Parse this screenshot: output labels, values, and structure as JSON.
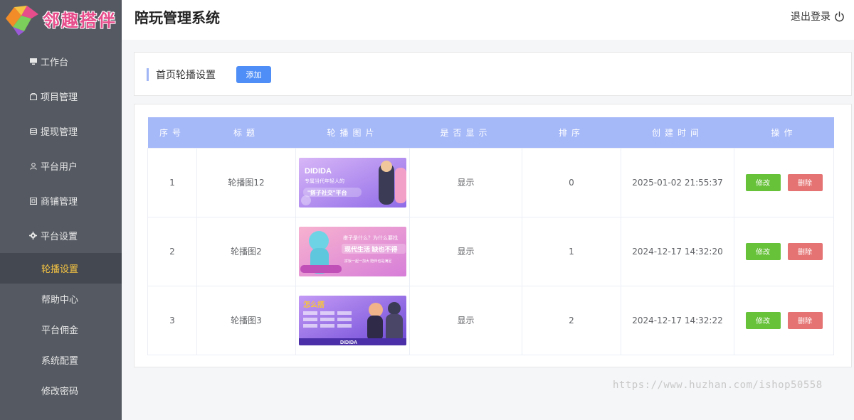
{
  "brand": {
    "logo_text": "邻趣搭伴"
  },
  "header": {
    "title": "陪玩管理系统",
    "logout_label": "退出登录"
  },
  "sidebar": {
    "items": [
      {
        "label": "工作台",
        "icon": "monitor-icon"
      },
      {
        "label": "项目管理",
        "icon": "box-icon"
      },
      {
        "label": "提现管理",
        "icon": "database-icon"
      },
      {
        "label": "平台用户",
        "icon": "user-icon"
      },
      {
        "label": "商铺管理",
        "icon": "store-icon"
      },
      {
        "label": "平台设置",
        "icon": "gear-icon"
      }
    ],
    "sub_items": [
      {
        "label": "轮播设置",
        "active": true
      },
      {
        "label": "帮助中心",
        "active": false
      },
      {
        "label": "平台佣金",
        "active": false
      },
      {
        "label": "系统配置",
        "active": false
      },
      {
        "label": "修改密码",
        "active": false
      }
    ]
  },
  "section": {
    "title": "首页轮播设置",
    "add_label": "添加"
  },
  "table": {
    "headers": [
      "序号",
      "标题",
      "轮播图片",
      "是否显示",
      "排序",
      "创建时间",
      "操作"
    ],
    "edit_label": "修改",
    "delete_label": "删除",
    "rows": [
      {
        "index": "1",
        "title": "轮播图12",
        "shown": "显示",
        "sort": "0",
        "created": "2025-01-02 21:55:37",
        "banner": {
          "lines": [
            "DIDIDA",
            "专属当代年轻人的",
            "\"搭子社交\"平台"
          ],
          "colors": [
            "#c9a6f5",
            "#8a63e8"
          ]
        }
      },
      {
        "index": "2",
        "title": "轮播图2",
        "shown": "显示",
        "sort": "1",
        "created": "2024-12-17 14:32:20",
        "banner": {
          "lines": [
            "搭子是什么？为什么要找",
            "现代生活 缺也不得",
            "拼饭一起一加大 陪伴也是满足"
          ],
          "colors": [
            "#f6a3c4",
            "#d97ad8"
          ]
        }
      },
      {
        "index": "3",
        "title": "轮播图3",
        "shown": "显示",
        "sort": "2",
        "created": "2024-12-17 14:32:22",
        "banner": {
          "lines": [
            "怎么搭",
            "DIDIDA"
          ],
          "colors": [
            "#b787f2",
            "#6f4ad8"
          ]
        }
      }
    ]
  },
  "watermark": "https://www.huzhan.com/ishop50558"
}
